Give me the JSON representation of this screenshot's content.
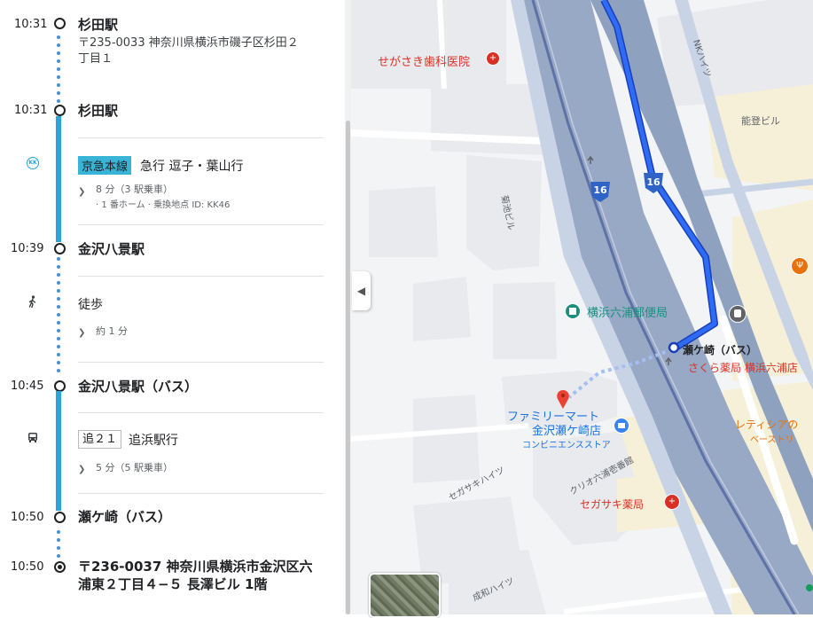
{
  "itinerary": {
    "steps": [
      {
        "time": "10:31",
        "stop": "杉田駅",
        "address": [
          "〒235-0033 神奈川県横浜市磯子区杉田２",
          "丁目１"
        ]
      },
      {
        "time": "10:31",
        "stop": "杉田駅"
      },
      {
        "line": "京急本線",
        "service": "急行 逗子・葉山行",
        "duration": "8 分（3 駅乗車）",
        "note": "· 1 番ホーム · 乗換地点 ID: KK46",
        "icon_text": "KK"
      },
      {
        "time": "10:39",
        "stop": "金沢八景駅"
      },
      {
        "walk_label": "徒歩",
        "walk_duration": "約 1 分"
      },
      {
        "time": "10:45",
        "stop": "金沢八景駅（バス）"
      },
      {
        "bus_badge": "追２１",
        "bus_service": "追浜駅行",
        "bus_duration": "5 分（5 駅乗車）"
      },
      {
        "time": "10:50",
        "stop": "瀬ケ崎（バス）"
      },
      {
        "time": "10:50",
        "address": [
          "〒236-0037 神奈川県横浜市金沢区六",
          "浦東２丁目４−５ 長澤ビル 1階"
        ]
      }
    ]
  },
  "map": {
    "labels": {
      "segasaki_dental": "せがさき歯科医院",
      "nk_heights": "NKハイツ",
      "nouken_bldg": "能登ビル",
      "kikuike_bldg": "菊池ビル",
      "route16a": "16",
      "route16b": "16",
      "post_office": "横浜六浦郵便局",
      "bus_stop": "瀬ケ崎（バス）",
      "sakura_pharmacy": "さくら薬局 横浜六浦店",
      "familymart_1": "ファミリーマート",
      "familymart_2": "金沢瀬ケ崎店",
      "convenience": "コンビニエンスストア",
      "letizia_1": "レティシアの",
      "letizia_2": "ベーストリ",
      "segasaki_heights": "セガサキハイツ",
      "clio": "クリオ六浦壱番館",
      "segasaki_pharmacy": "セガサキ薬局",
      "seiwa_heights": "成和ハイツ"
    }
  },
  "colors": {
    "rail_line": "#2aa4d9",
    "route": "#1a56f0",
    "marker": "#ea4335",
    "poi_teal": "#1a8f7e",
    "poi_red": "#d93025"
  }
}
